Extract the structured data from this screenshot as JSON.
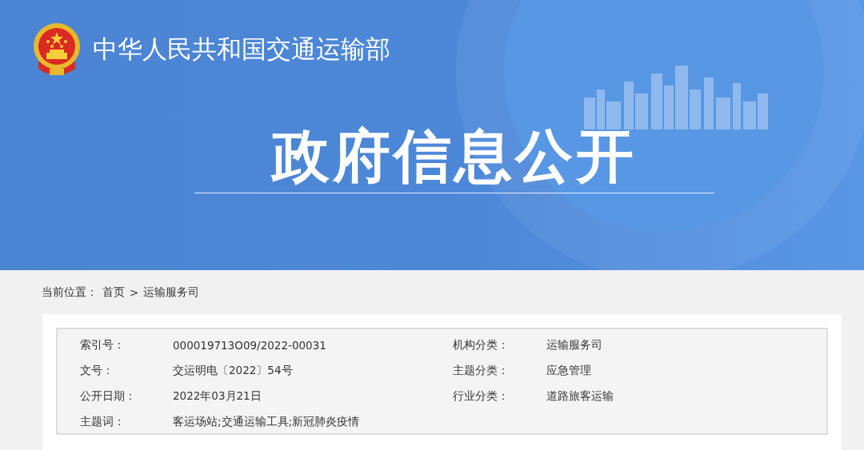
{
  "header": {
    "ministry_name": "中华人民共和国交通运输部",
    "section_title": "政府信息公开"
  },
  "breadcrumb": {
    "label": "当前位置：",
    "items": [
      "首页",
      "运输服务司"
    ],
    "separator": ">"
  },
  "info": {
    "left": [
      {
        "label": "索引号：",
        "value": "000019713O09/2022-00031"
      },
      {
        "label": "文号：",
        "value": "交运明电〔2022〕54号"
      },
      {
        "label": "公开日期：",
        "value": "2022年03月21日"
      },
      {
        "label": "主题词：",
        "value": "客运场站;交通运输工具;新冠肺炎疫情"
      }
    ],
    "right": [
      {
        "label": "机构分类：",
        "value": "运输服务司"
      },
      {
        "label": "主题分类：",
        "value": "应急管理"
      },
      {
        "label": "行业分类：",
        "value": "道路旅客运输"
      }
    ]
  }
}
